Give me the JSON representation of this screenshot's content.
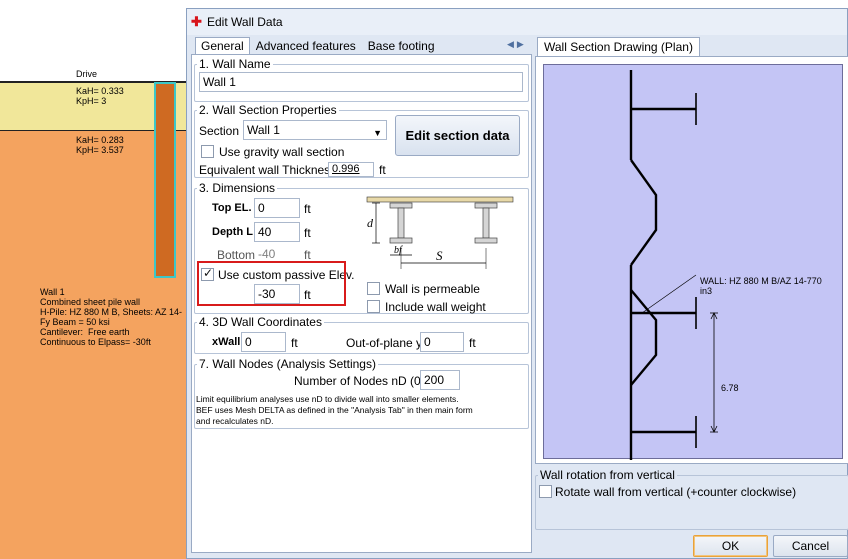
{
  "model": {
    "drive_label": "Drive",
    "layer1": "KaH= 0.333\nKpH= 3",
    "layer2": "KaH= 0.283\nKpH= 3.537",
    "wall_info": "Wall 1\nCombined sheet pile wall\nH-Pile: HZ 880 M B, Sheets: AZ 14-\nFy Beam = 50 ksi\nCantilever:  Free earth\nContinuous to Elpass= -30ft"
  },
  "dialog": {
    "title": "Edit Wall Data",
    "tabs": [
      "General",
      "Advanced features",
      "Base footing"
    ],
    "active_tab": "General",
    "right_tab": "Wall Section Drawing (Plan)"
  },
  "wall_name": {
    "legend": "1. Wall Name",
    "value": "Wall 1"
  },
  "section_props": {
    "legend": "2. Wall Section Properties",
    "section_label": "Section",
    "section_value": "Wall 1",
    "gravity_label": "Use gravity wall section",
    "gravity_checked": false,
    "edit_button": "Edit section data",
    "thickness_label": "Equivalent wall Thickness:",
    "thickness_value": "0.996",
    "thickness_unit": "ft"
  },
  "dimensions": {
    "legend": "3. Dimensions",
    "top_label": "Top EL.",
    "top_value": "0",
    "depth_label": "Depth L",
    "depth_value": "40",
    "bottom_label": "Bottom",
    "bottom_value": "-40",
    "unit": "ft",
    "custom_passive_label": "Use custom passive Elev.",
    "custom_passive_checked": true,
    "custom_passive_value": "-30",
    "permeable_label": "Wall is permeable",
    "weight_label": "Include wall weight",
    "diagram": {
      "d": "d",
      "bf": "bf",
      "s": "S"
    }
  },
  "coords": {
    "legend": "4. 3D Wall Coordinates",
    "xwall_label": "xWall",
    "xwall_value": "0",
    "outplane_label": "Out-of-plane y",
    "outplane_value": "0",
    "unit": "ft"
  },
  "nodes": {
    "legend": "7. Wall Nodes (Analysis Settings)",
    "num_label": "Number of Nodes nD (0-",
    "num_value": "200",
    "note": "Limit equilibrium analyses use nD to divide wall into smaller elements.\nBEF uses Mesh DELTA as defined in the \"Analysis Tab\" in then main form\nand recalculates nD."
  },
  "drawing": {
    "wall_label": "WALL: HZ 880 M B/AZ 14-770\nin3",
    "dimension": "6.78"
  },
  "rotation": {
    "legend": "Wall rotation from vertical",
    "check_label": "Rotate wall from vertical (+counter clockwise)"
  },
  "buttons": {
    "ok": "OK",
    "cancel": "Cancel"
  },
  "colors": {
    "top_layer": "#f1e79a",
    "bottom_layer": "#f4a35f",
    "pile": "#cf6a22",
    "drawing_bg": "#c4c5f5",
    "highlight": "#d81b1b"
  }
}
